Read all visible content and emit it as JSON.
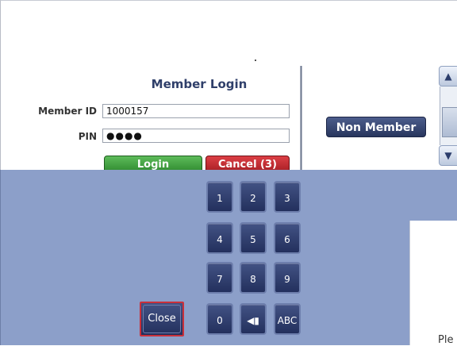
{
  "login_form": {
    "title": "Member Login",
    "member_id_label": "Member ID",
    "member_id_value": "1000157",
    "pin_label": "PIN",
    "pin_value": "●●●●",
    "login_button": "Login",
    "cancel_button": "Cancel (3)"
  },
  "non_member_button": "Non Member",
  "scrollbar": {
    "up_icon": "chevron-up-icon",
    "down_icon": "chevron-down-icon"
  },
  "keypad": {
    "keys": [
      "1",
      "2",
      "3",
      "4",
      "5",
      "6",
      "7",
      "8",
      "9",
      "0"
    ],
    "backspace_icon": "backspace-icon",
    "abc_key": "ABC",
    "close_button": "Close"
  },
  "right_pane_text": "Ple",
  "colors": {
    "keypad_panel": "#8c9fc9",
    "key_bg": "#2d3a68",
    "login_green": "#3a9b3a",
    "cancel_red": "#b8252b",
    "title_blue": "#2f3f6a",
    "close_outline_red": "#c9303a"
  }
}
